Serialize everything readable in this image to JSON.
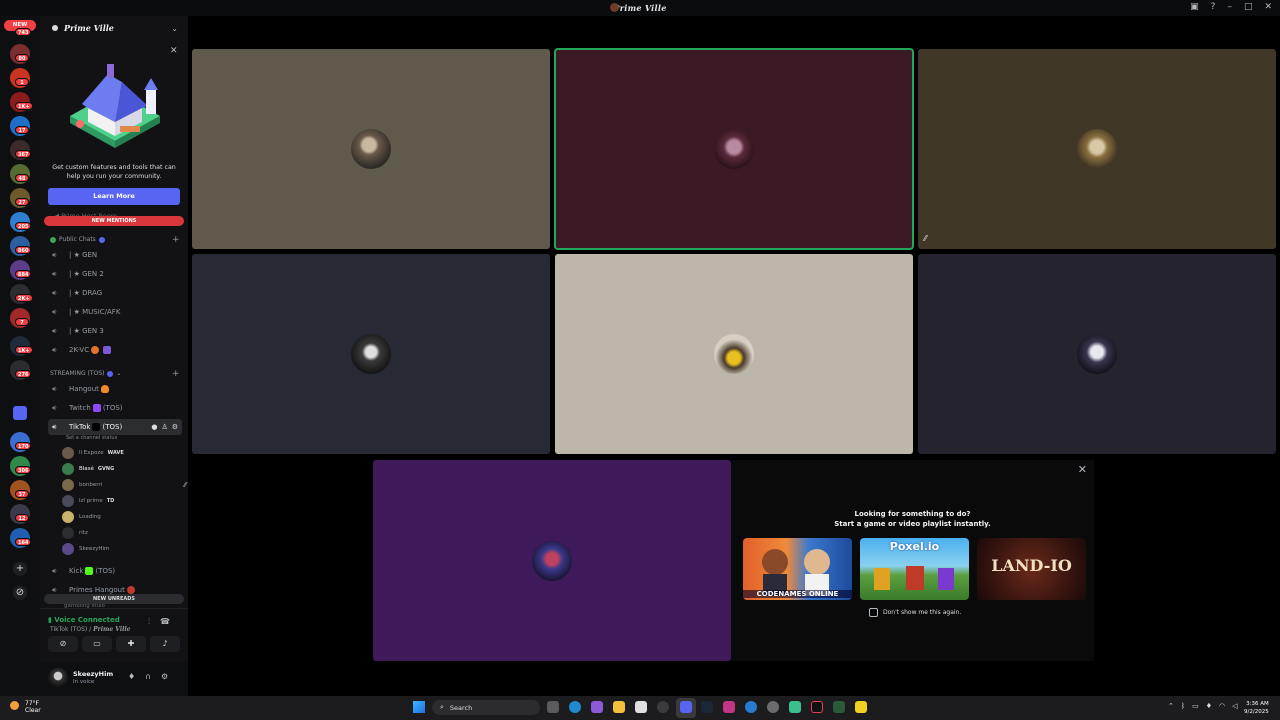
{
  "window": {
    "title": "Prime Ville",
    "controls": [
      "inbox-icon",
      "help-icon",
      "minimize-icon",
      "maximize-icon",
      "close-icon"
    ]
  },
  "server_rail": {
    "new_label": "NEW",
    "badges": [
      "743",
      "80",
      "1",
      "1K+",
      "17",
      "367",
      "48",
      "27",
      "205",
      "860",
      "884",
      "2K+",
      "7",
      "1K+",
      "276",
      "170",
      "306",
      "37",
      "12",
      "164"
    ]
  },
  "server": {
    "name": "Prime Ville"
  },
  "promo": {
    "text": "Get custom features and tools that can help you run your community.",
    "button": "Learn More"
  },
  "sidebar": {
    "faded_top": "Prime Host Room",
    "new_mentions": "NEW MENTIONS",
    "categories": {
      "public": "Public Chats",
      "streaming": "STREAMING (TOS)"
    },
    "channels": [
      {
        "label": "| ★ GEN"
      },
      {
        "label": "| ★ GEN 2"
      },
      {
        "label": "| ★ DRAG"
      },
      {
        "label": "| ★ MUSIC/AFK"
      },
      {
        "label": "| ★ GEN 3"
      },
      {
        "label": "2K-VC"
      },
      {
        "label": "Hangout"
      },
      {
        "label": "Twitch",
        "suffix": "(TOS)"
      },
      {
        "label": "TikTok",
        "suffix": "(TOS)"
      },
      {
        "label": "Kick",
        "suffix": "(TOS)"
      },
      {
        "label": "Primes Hangout"
      }
    ],
    "channel_status_hint": "Set a channel status",
    "voice_users": [
      {
        "name": "ll Expoze",
        "tag": "WAVE"
      },
      {
        "name": "Blasé",
        "tag": "GVNG"
      },
      {
        "name": "bonberri",
        "tag": ""
      },
      {
        "name": "lzl prime",
        "tag": "TD"
      },
      {
        "name": "Loading",
        "tag": ""
      },
      {
        "name": "ritz",
        "tag": ""
      },
      {
        "name": "SkeezyHim",
        "tag": ""
      }
    ],
    "faded_bottom": "gambling stuio",
    "new_unreads": "NEW UNREADS"
  },
  "voice_panel": {
    "status": "Voice Connected",
    "channel": "TikTok",
    "channel_suffix": "(TOS) /",
    "server": "Prime Ville"
  },
  "user": {
    "name": "SkeezyHim",
    "status": "In voice"
  },
  "activity": {
    "title": "Looking for something to do?",
    "subtitle": "Start a game or video playlist instantly.",
    "games": [
      "CODENAMES ONLINE",
      "Poxel.io",
      "LAND-IO"
    ],
    "dont_show": "Don't show me this again."
  },
  "taskbar": {
    "temp": "77°F",
    "weather": "Clear",
    "search": "Search",
    "time": "3:36 AM",
    "date": "9/2/2025"
  },
  "colors": {
    "speaking": "#23a55a",
    "blurple": "#5865f2",
    "mention_red": "#da373c"
  }
}
